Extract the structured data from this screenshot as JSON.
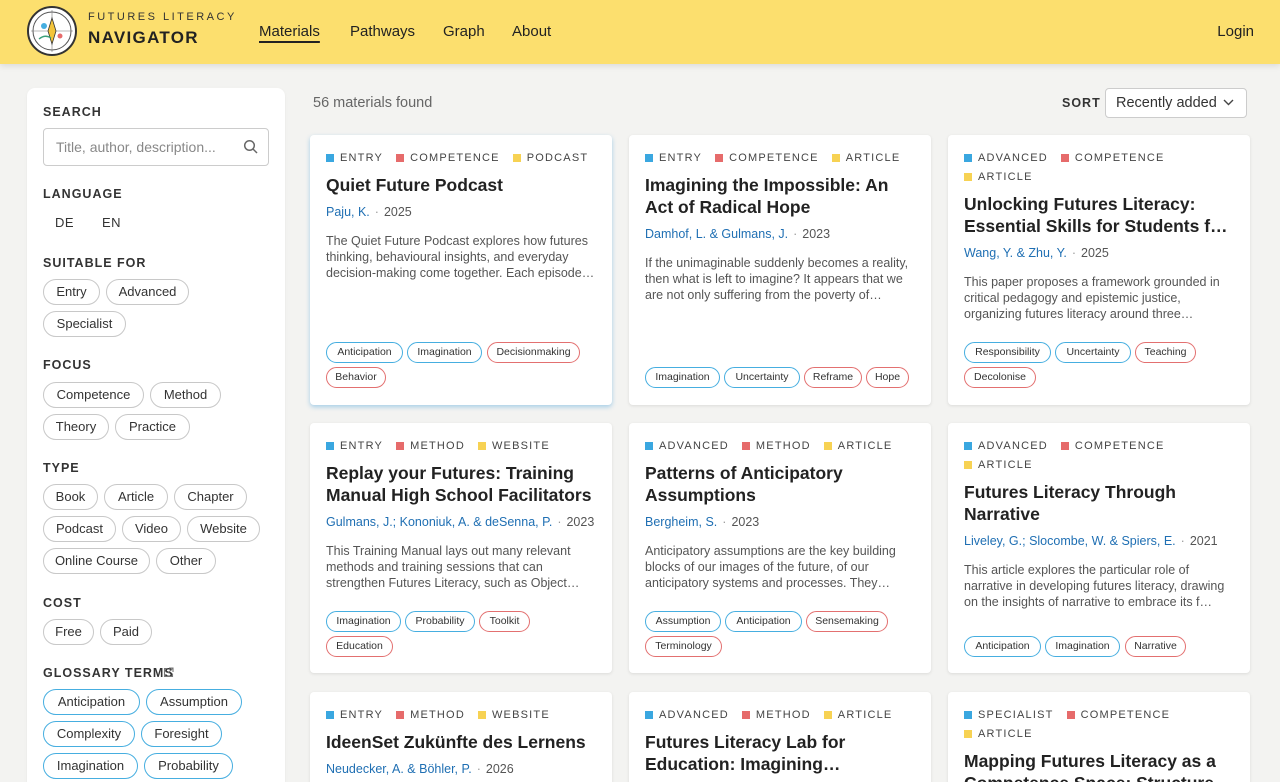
{
  "colors": {
    "header_bg": "#fcdf6e",
    "level": "#3aa7e0",
    "focus": "#e66b6b",
    "type": "#f7d253",
    "link": "#1f6fb3"
  },
  "header": {
    "brand_sub": "FUTURES LITERACY",
    "brand_main": "NAVIGATOR",
    "nav": [
      "Materials",
      "Pathways",
      "Graph",
      "About"
    ],
    "active_nav": "Materials",
    "login": "Login"
  },
  "sidebar": {
    "search_title": "SEARCH",
    "search_placeholder": "Title, author, description...",
    "language_title": "LANGUAGE",
    "languages": [
      "DE",
      "EN"
    ],
    "suitable_title": "SUITABLE FOR",
    "suitable": [
      "Entry",
      "Advanced",
      "Specialist"
    ],
    "focus_title": "FOCUS",
    "focus": [
      "Competence",
      "Method",
      "Theory",
      "Practice"
    ],
    "type_title": "TYPE",
    "types": [
      "Book",
      "Article",
      "Chapter",
      "Podcast",
      "Video",
      "Website",
      "Online Course",
      "Other"
    ],
    "cost_title": "COST",
    "cost": [
      "Free",
      "Paid"
    ],
    "glossary_title": "GLOSSARY TERMS",
    "glossary": [
      "Anticipation",
      "Assumption",
      "Complexity",
      "Foresight",
      "Imagination",
      "Probability"
    ]
  },
  "main": {
    "count": "56 materials found",
    "sort_label": "SORT",
    "sort_value": "Recently added",
    "cards": [
      {
        "meta": [
          [
            "level",
            "ENTRY"
          ],
          [
            "focus",
            "COMPETENCE"
          ],
          [
            "type",
            "PODCAST"
          ]
        ],
        "title": "Quiet Future Podcast",
        "authors": "Paju, K.",
        "year": "2025",
        "desc": "The Quiet Future Podcast explores how futures thinking, behavioural insights, and everyday decision-making come together. Each episode…",
        "tags": [
          [
            "Anticipation",
            "blue"
          ],
          [
            "Imagination",
            "blue"
          ],
          [
            "Decisionmaking",
            "red"
          ],
          [
            "Behavior",
            "red"
          ]
        ]
      },
      {
        "meta": [
          [
            "level",
            "ENTRY"
          ],
          [
            "focus",
            "COMPETENCE"
          ],
          [
            "type",
            "ARTICLE"
          ]
        ],
        "title": "Imagining the Impossible: An Act of Radical Hope",
        "authors": "Damhof, L. & Gulmans, J.",
        "year": "2023",
        "desc": "If the unimaginable suddenly becomes a reality, then what is left to imagine? It appears that we are not only suffering from the poverty of…",
        "tags": [
          [
            "Imagination",
            "blue"
          ],
          [
            "Uncertainty",
            "blue"
          ],
          [
            "Reframe",
            "red"
          ],
          [
            "Hope",
            "red"
          ]
        ]
      },
      {
        "meta": [
          [
            "level",
            "ADVANCED"
          ],
          [
            "focus",
            "COMPETENCE"
          ],
          [
            "type",
            "ARTICLE"
          ]
        ],
        "title": "Unlocking Futures Literacy: Essential Skills for Students for a…",
        "authors": "Wang, Y. & Zhu, Y.",
        "year": "2025",
        "desc": "This paper proposes a framework grounded in critical pedagogy and epistemic justice, organizing futures literacy around three…",
        "tags": [
          [
            "Responsibility",
            "blue"
          ],
          [
            "Uncertainty",
            "blue"
          ],
          [
            "Teaching",
            "red"
          ],
          [
            "Decolonise",
            "red"
          ]
        ]
      },
      {
        "meta": [
          [
            "level",
            "ENTRY"
          ],
          [
            "focus",
            "METHOD"
          ],
          [
            "type",
            "WEBSITE"
          ]
        ],
        "title": "Replay your Futures: Training Manual High School Facilitators",
        "authors": "Gulmans, J.; Kononiuk, A. & deSenna, P.",
        "year": "2023",
        "desc": "This Training Manual lays out many relevant methods and training sessions that can strengthen Futures Literacy, such as Object…",
        "tags": [
          [
            "Imagination",
            "blue"
          ],
          [
            "Probability",
            "blue"
          ],
          [
            "Toolkit",
            "red"
          ],
          [
            "Education",
            "red"
          ]
        ]
      },
      {
        "meta": [
          [
            "level",
            "ADVANCED"
          ],
          [
            "focus",
            "METHOD"
          ],
          [
            "type",
            "ARTICLE"
          ]
        ],
        "title": "Patterns of Anticipatory Assumptions",
        "authors": "Bergheim, S.",
        "year": "2023",
        "desc": "Anticipatory assumptions are the key building blocks of our images of the future, of our anticipatory systems and processes. They…",
        "tags": [
          [
            "Assumption",
            "blue"
          ],
          [
            "Anticipation",
            "blue"
          ],
          [
            "Sensemaking",
            "red"
          ],
          [
            "Terminology",
            "red"
          ]
        ]
      },
      {
        "meta": [
          [
            "level",
            "ADVANCED"
          ],
          [
            "focus",
            "COMPETENCE"
          ],
          [
            "type",
            "ARTICLE"
          ]
        ],
        "title": "Futures Literacy Through Narrative",
        "authors": "Liveley, G.; Slocombe, W. & Spiers, E.",
        "year": "2021",
        "desc": "This article explores the particular role of narrative in developing futures literacy, drawing on the insights of narrative to embrace its f…",
        "tags": [
          [
            "Anticipation",
            "blue"
          ],
          [
            "Imagination",
            "blue"
          ],
          [
            "Narrative",
            "red"
          ]
        ]
      },
      {
        "meta": [
          [
            "level",
            "ENTRY"
          ],
          [
            "focus",
            "METHOD"
          ],
          [
            "type",
            "WEBSITE"
          ]
        ],
        "title": "IdeenSet Zukünfte des Lernens",
        "authors": "Neudecker, A. & Böhler, P.",
        "year": "2026",
        "desc": "",
        "tags": []
      },
      {
        "meta": [
          [
            "level",
            "ADVANCED"
          ],
          [
            "focus",
            "METHOD"
          ],
          [
            "type",
            "ARTICLE"
          ]
        ],
        "title": "Futures Literacy Lab for Education: Imagining Complex…",
        "authors": "",
        "year": "",
        "desc": "",
        "tags": []
      },
      {
        "meta": [
          [
            "level",
            "SPECIALIST"
          ],
          [
            "focus",
            "COMPETENCE"
          ],
          [
            "type",
            "ARTICLE"
          ]
        ],
        "title": "Mapping Futures Literacy as a Competence Space: Structure…",
        "authors": "",
        "year": "",
        "desc": "",
        "tags": []
      }
    ]
  }
}
